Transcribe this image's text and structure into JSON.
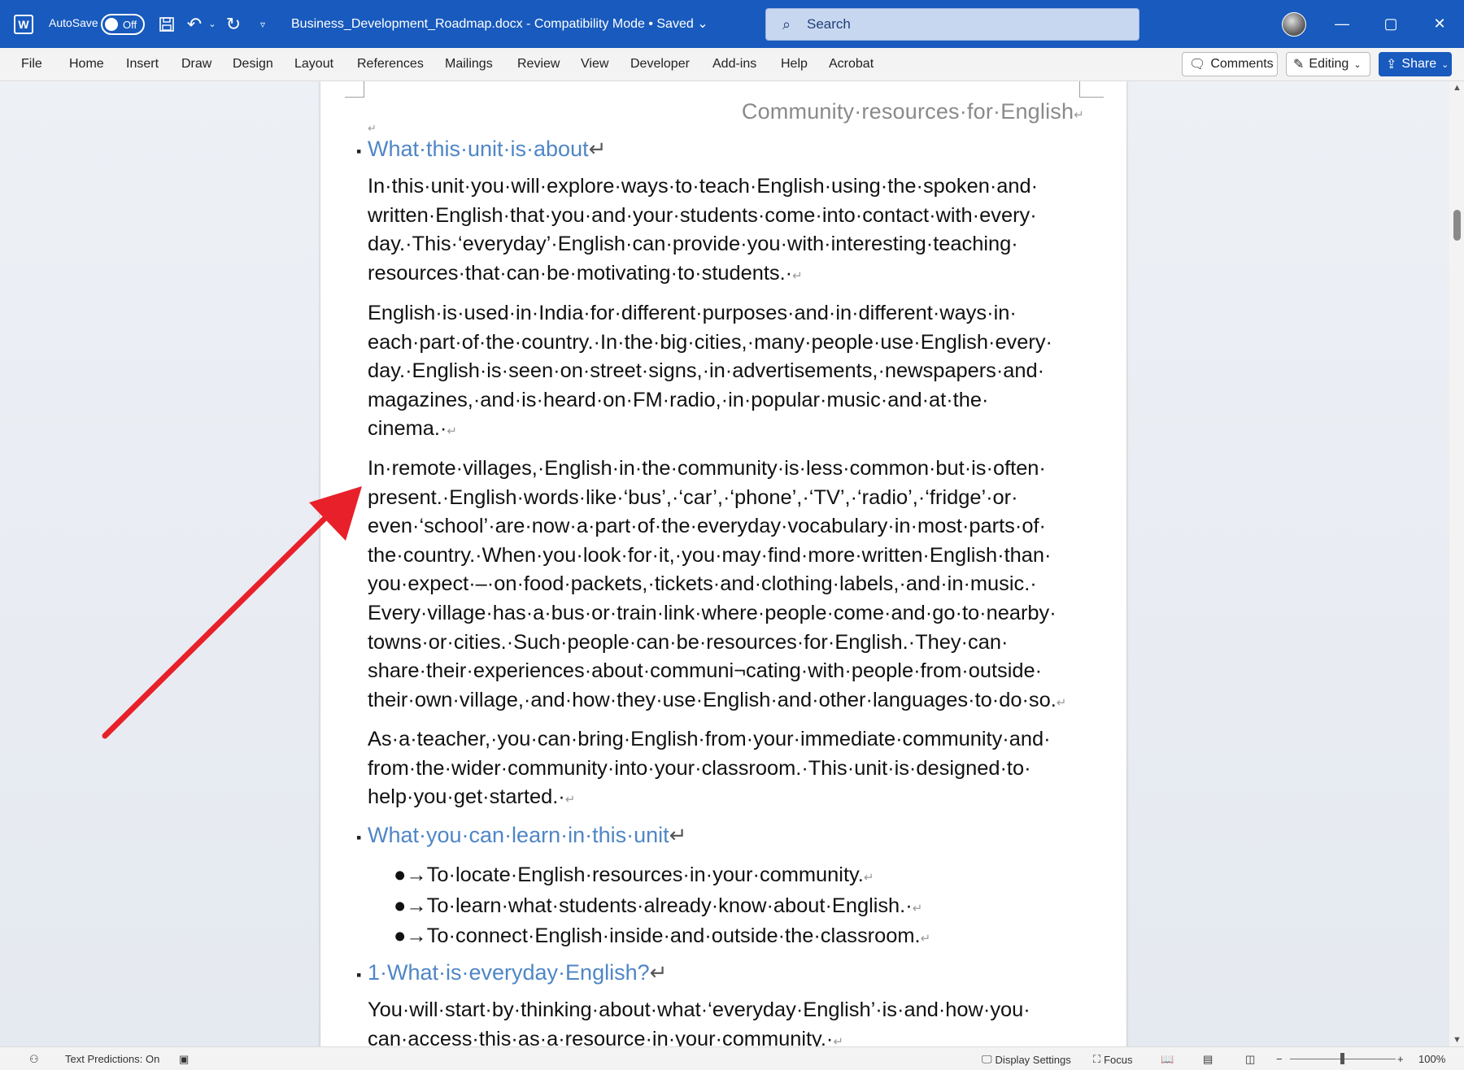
{
  "titlebar": {
    "autosave_label": "AutoSave",
    "autosave_state": "Off",
    "doc_title": "Business_Development_Roadmap.docx  -  Compatibility Mode  •  Saved",
    "search_placeholder": "Search",
    "color": "#185abd"
  },
  "ribbon": {
    "tabs": [
      "File",
      "Home",
      "Insert",
      "Draw",
      "Design",
      "Layout",
      "References",
      "Mailings",
      "Review",
      "View",
      "Developer",
      "Add-ins",
      "Help",
      "Acrobat"
    ],
    "comments_label": "Comments",
    "editing_label": "Editing",
    "share_label": "Share"
  },
  "document": {
    "header": "Community·resources·for·English",
    "headings": [
      "What·this·unit·is·about",
      "What·you·can·learn·in·this·unit",
      "1·What·is·everyday·English?"
    ],
    "paragraphs": [
      "In·this·unit·you·will·explore·ways·to·teach·English·using·the·spoken·and· written·English·that·you·and·your·students·come·into·contact·with·every· day.·This·‘everyday’·English·can·provide·you·with·interesting·teaching· resources·that·can·be·motivating·to·students.·",
      "English·is·used·in·India·for·different·purposes·and·in·different·ways·in· each·part·of·the·country.·In·the·big·cities,·many·people·use·English·every· day.·English·is·seen·on·street·signs,·in·advertisements,·newspapers·and· magazines,·and·is·heard·on·FM·radio,·in·popular·music·and·at·the· cinema.·",
      "In·remote·villages,·English·in·the·community·is·less·common·but·is·often· present.·English·words·like·‘bus’,·‘car’,·‘phone’,·‘TV’,·‘radio’,·‘fridge’·or· even·‘school’·are·now·a·part·of·the·everyday·vocabulary·in·most·parts·of· the·country.·When·you·look·for·it,·you·may·find·more·written·English·than· you·expect·–·on·food·packets,·tickets·and·clothing·labels,·and·in·music.· Every·village·has·a·bus·or·train·link·where·people·come·and·go·to·nearby· towns·or·cities.·Such·people·can·be·resources·for·English.·They·can· share·their·experiences·about·communi¬cating·with·people·from·outside· their·own·village,·and·how·they·use·English·and·other·languages·to·do·so.",
      "As·a·teacher,·you·can·bring·English·from·your·immediate·community·and· from·the·wider·community·into·your·classroom.·This·unit·is·designed·to· help·you·get·started.·",
      "You·will·start·by·thinking·about·what·‘everyday·English’·is·and·how·you· can·access·this·as·a·resource·in·your·community.·"
    ],
    "list_items": [
      "●→To·locate·English·resources·in·your·community.",
      "●→To·learn·what·students·already·know·about·English.·",
      "●→To·connect·English·inside·and·outside·the·classroom."
    ],
    "heading_color": "#4f86c6",
    "annotation_color": "#e8202a"
  },
  "statusbar": {
    "text_predictions": "Text Predictions: On",
    "display_settings": "Display Settings",
    "focus": "Focus",
    "zoom": "100%"
  }
}
